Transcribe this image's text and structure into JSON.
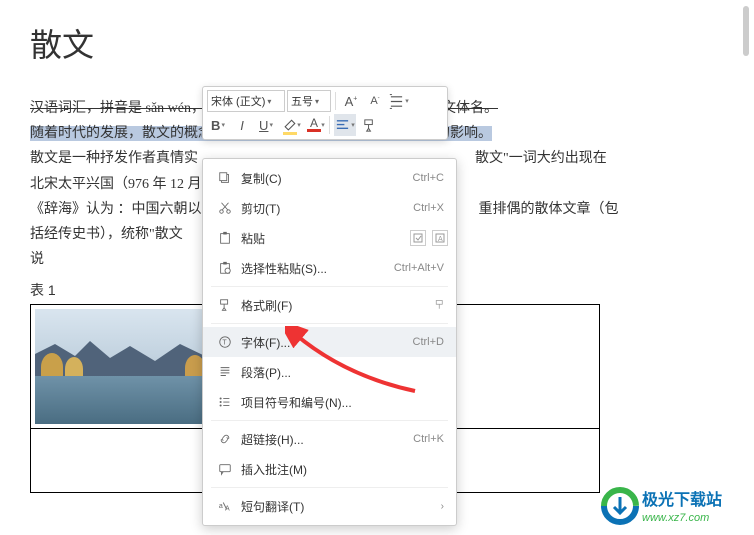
{
  "doc": {
    "title": "散文",
    "line1_a": "汉语词汇，拼音是 sǎn wén，",
    "line1_b": "文体名。",
    "sel_line": "随着时代的发展，散文的概念由广义向狭义转变，并受到西方文化的影响。",
    "p2_a": "散文是一种抒发作者真情实",
    "p2_b": "散文\"一词大约出现在",
    "p3": "北宋太平兴国（976 年 12 月",
    "p4_a": "《辞海》认为 ：中国六朝以",
    "p4_b": "重排偶的散体文章（包",
    "p5": "括经传史书），统称\"散文",
    "p6": "说",
    "table_label": "表 1"
  },
  "toolbar": {
    "font_name": "宋体 (正文)",
    "font_size": "五号"
  },
  "menu": {
    "copy": "复制(C)",
    "copy_sc": "Ctrl+C",
    "cut": "剪切(T)",
    "cut_sc": "Ctrl+X",
    "paste": "粘贴",
    "paste_sel": "选择性粘贴(S)...",
    "paste_sel_sc": "Ctrl+Alt+V",
    "format": "格式刷(F)",
    "font": "字体(F)...",
    "font_sc": "Ctrl+D",
    "para": "段落(P)...",
    "bullets": "项目符号和编号(N)...",
    "link": "超链接(H)...",
    "link_sc": "Ctrl+K",
    "comment": "插入批注(M)",
    "translate": "短句翻译(T)"
  },
  "logo": {
    "text": "极光下载站",
    "url": "www.xz7.com"
  }
}
